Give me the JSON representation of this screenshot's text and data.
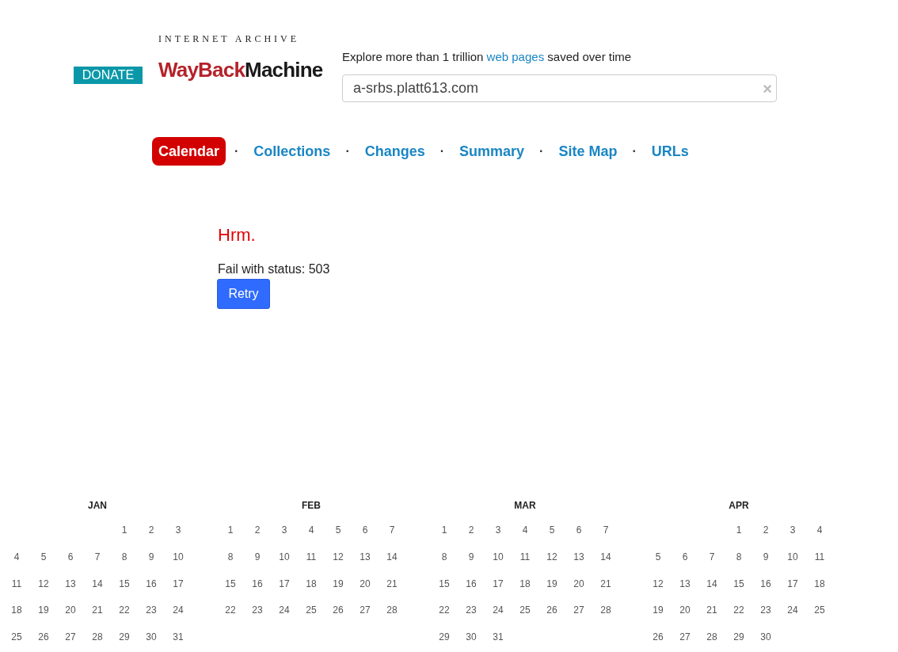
{
  "donate_button": "DONATE",
  "logo": {
    "top_line": "INTERNET ARCHIVE",
    "word_1": "WayBack",
    "word_2": "Machine"
  },
  "tagline": {
    "before": "Explore more than 1 trillion ",
    "link": "web pages",
    "after": " saved over time"
  },
  "search": {
    "value": "a-srbs.platt613.com",
    "clear": "×"
  },
  "tabs": [
    {
      "label": "Calendar",
      "selected": true
    },
    {
      "label": "Collections",
      "selected": false
    },
    {
      "label": "Changes",
      "selected": false
    },
    {
      "label": "Summary",
      "selected": false
    },
    {
      "label": "Site Map",
      "selected": false
    },
    {
      "label": "URLs",
      "selected": false
    }
  ],
  "tab_separator": "·",
  "error": {
    "title": "Hrm.",
    "message": "Fail with status: 503",
    "button": "Retry"
  },
  "calendar": {
    "months": [
      {
        "name": "JAN",
        "weeks": [
          [
            "1",
            "2",
            "3"
          ],
          [
            "4",
            "5",
            "6",
            "7",
            "8",
            "9",
            "10"
          ],
          [
            "11",
            "12",
            "13",
            "14",
            "15",
            "16",
            "17"
          ],
          [
            "18",
            "19",
            "20",
            "21",
            "22",
            "23",
            "24"
          ],
          [
            "25",
            "26",
            "27",
            "28",
            "29",
            "30",
            "31"
          ]
        ]
      },
      {
        "name": "FEB",
        "weeks": [
          [
            "1",
            "2",
            "3",
            "4",
            "5",
            "6",
            "7"
          ],
          [
            "8",
            "9",
            "10",
            "11",
            "12",
            "13",
            "14"
          ],
          [
            "15",
            "16",
            "17",
            "18",
            "19",
            "20",
            "21"
          ],
          [
            "22",
            "23",
            "24",
            "25",
            "26",
            "27",
            "28"
          ]
        ]
      },
      {
        "name": "MAR",
        "weeks": [
          [
            "1",
            "2",
            "3",
            "4",
            "5",
            "6",
            "7"
          ],
          [
            "8",
            "9",
            "10",
            "11",
            "12",
            "13",
            "14"
          ],
          [
            "15",
            "16",
            "17",
            "18",
            "19",
            "20",
            "21"
          ],
          [
            "22",
            "23",
            "24",
            "25",
            "26",
            "27",
            "28"
          ],
          [
            "29",
            "30",
            "31"
          ]
        ]
      },
      {
        "name": "APR",
        "weeks": [
          [
            "1",
            "2",
            "3",
            "4"
          ],
          [
            "5",
            "6",
            "7",
            "8",
            "9",
            "10",
            "11"
          ],
          [
            "12",
            "13",
            "14",
            "15",
            "16",
            "17",
            "18"
          ],
          [
            "19",
            "20",
            "21",
            "22",
            "23",
            "24",
            "25"
          ],
          [
            "26",
            "27",
            "28",
            "29",
            "30"
          ]
        ]
      }
    ]
  }
}
